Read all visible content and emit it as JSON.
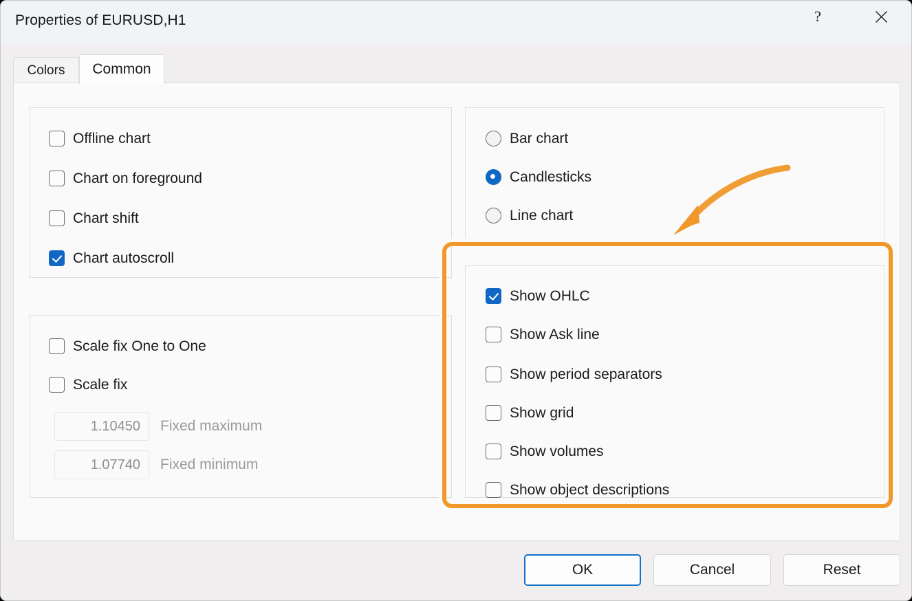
{
  "window": {
    "title": "Properties of EURUSD,H1",
    "help_icon": "question-mark-icon",
    "close_icon": "close-icon"
  },
  "tabs": [
    {
      "label": "Colors",
      "active": false
    },
    {
      "label": "Common",
      "active": true
    }
  ],
  "chart_options": {
    "items": [
      {
        "label": "Offline chart",
        "checked": false
      },
      {
        "label": "Chart on foreground",
        "checked": false
      },
      {
        "label": "Chart shift",
        "checked": false
      },
      {
        "label": "Chart autoscroll",
        "checked": true
      }
    ]
  },
  "scale_options": {
    "items": [
      {
        "label": "Scale fix One to One",
        "checked": false
      },
      {
        "label": "Scale fix",
        "checked": false
      }
    ],
    "fields": [
      {
        "value": "1.10450",
        "caption": "Fixed maximum",
        "disabled": true
      },
      {
        "value": "1.07740",
        "caption": "Fixed minimum",
        "disabled": true
      }
    ]
  },
  "chart_type": {
    "items": [
      {
        "label": "Bar chart",
        "selected": false
      },
      {
        "label": "Candlesticks",
        "selected": true
      },
      {
        "label": "Line chart",
        "selected": false
      }
    ]
  },
  "show_options": {
    "highlighted": true,
    "items": [
      {
        "label": "Show OHLC",
        "checked": true
      },
      {
        "label": "Show Ask line",
        "checked": false
      },
      {
        "label": "Show period separators",
        "checked": false
      },
      {
        "label": "Show grid",
        "checked": false
      },
      {
        "label": "Show volumes",
        "checked": false
      },
      {
        "label": "Show object descriptions",
        "checked": false
      }
    ]
  },
  "footer": {
    "ok_label": "OK",
    "cancel_label": "Cancel",
    "reset_label": "Reset"
  },
  "colors": {
    "accent_blue": "#1168c4",
    "annotation_orange": "#f0982a",
    "focus_blue": "#1272c8",
    "panel_bg": "#fafafa",
    "dialog_bg": "#f0eeee",
    "titlebar_bg": "#f1f4f6"
  }
}
